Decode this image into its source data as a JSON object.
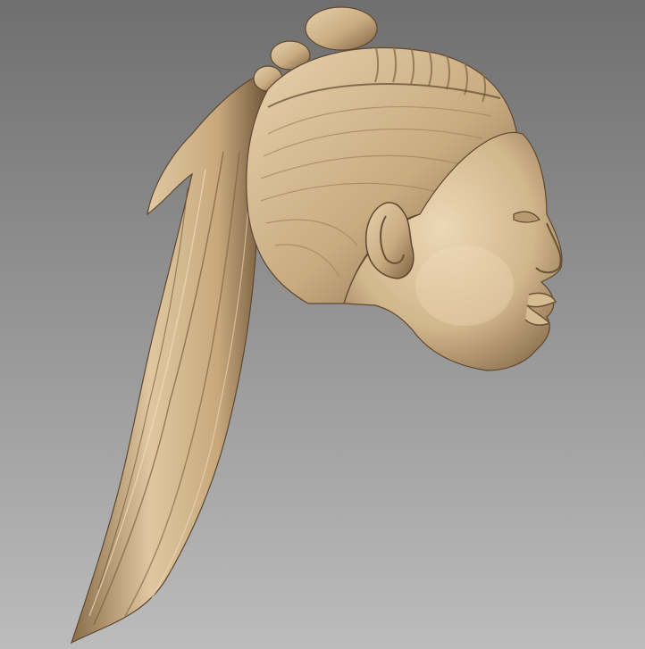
{
  "scene": {
    "subject": "sculpted-head-relief-icon",
    "colors": {
      "background_top": "#6f6f6f",
      "background_bottom": "#bcbcbc",
      "material_light": "#e7d1ad",
      "material_mid": "#c9ab80",
      "material_dark": "#7d6244",
      "material_shadow": "#4e3b26"
    }
  }
}
